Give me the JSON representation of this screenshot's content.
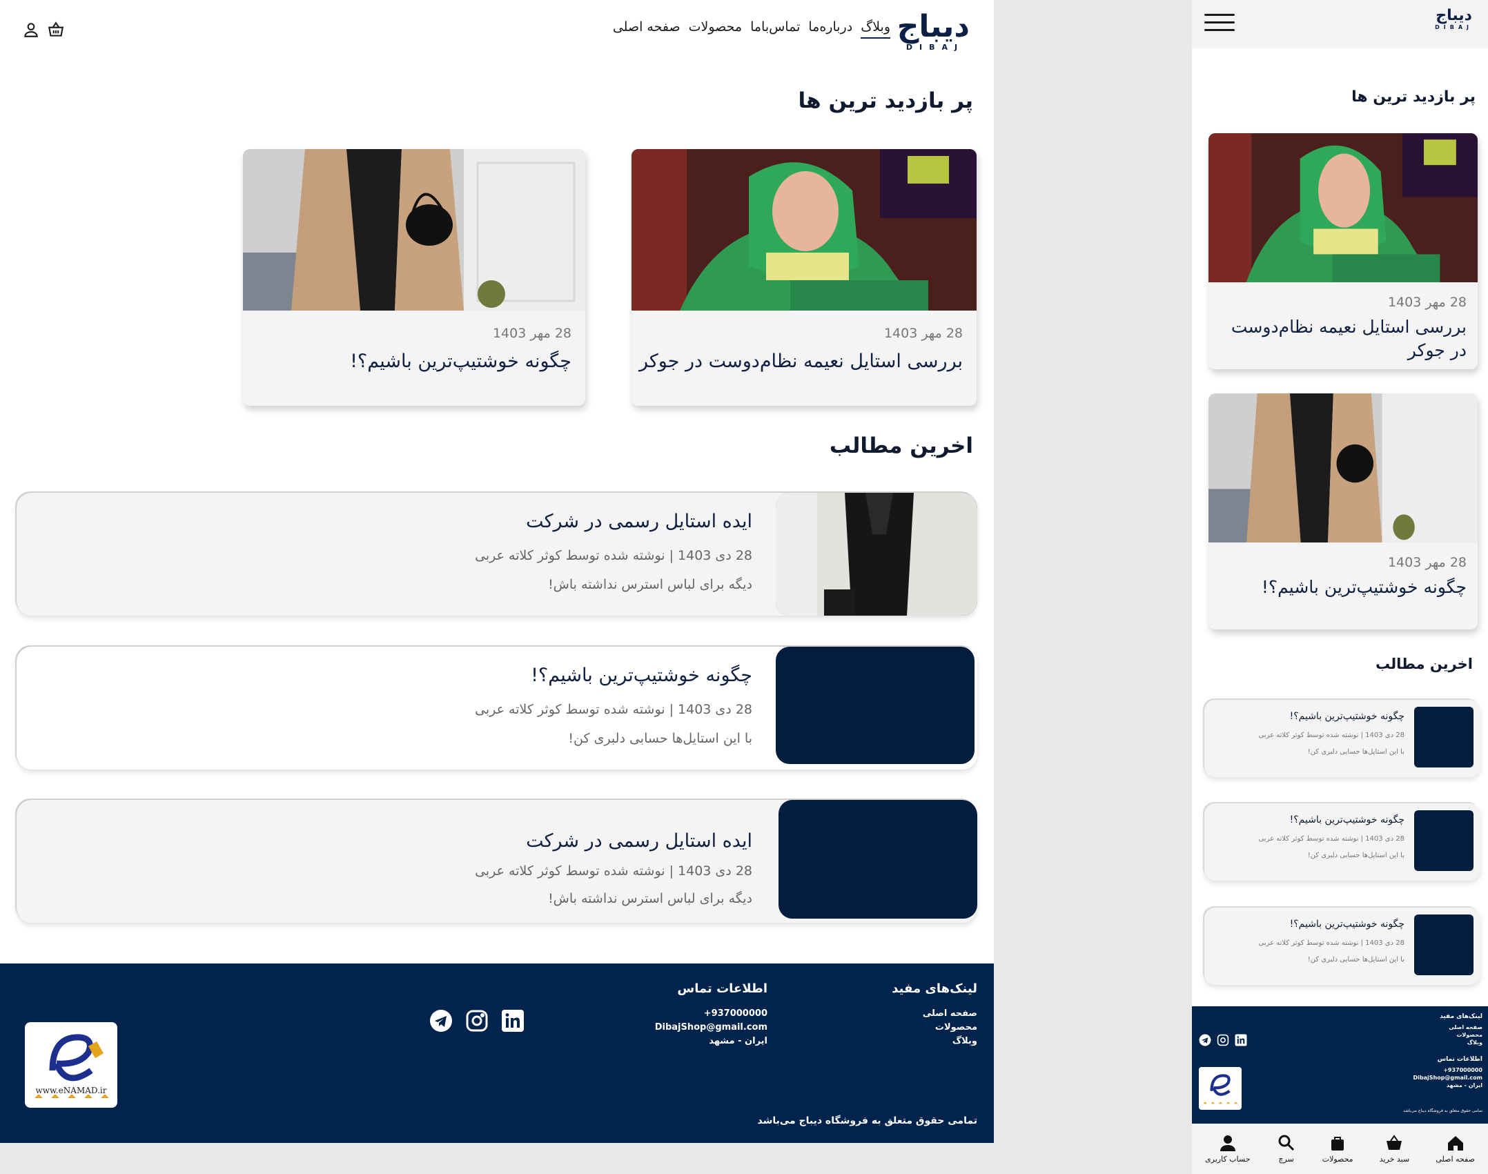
{
  "brand": {
    "name_fa": "دیباج",
    "name_en": "DIBAJ"
  },
  "nav": {
    "items": [
      "صفحه اصلی",
      "محصولات",
      "تماس‌باما",
      "درباره‌ما",
      "وبلاگ"
    ],
    "active": "وبلاگ"
  },
  "sections": {
    "popular_title": "پر بازدید ترین ها",
    "latest_title": "اخرین مطالب"
  },
  "popular": [
    {
      "date": "28 مهر 1403",
      "title": "بررسی استایل نعیمه نظام‌دوست در جوکر",
      "image": "woman-green-scarf"
    },
    {
      "date": "28 مهر 1403",
      "title": "چگونه خوشتیپ‌ترین باشیم؟!",
      "image": "coat-black-bag"
    }
  ],
  "latest": [
    {
      "title": "ایده استایل رسمی در شرکت",
      "meta": "28 دی 1403 | نوشته شده توسط کوثر کلاته عربی",
      "summary": "دیگه برای لباس استرس نداشته باش!"
    },
    {
      "title": "چگونه خوشتیپ‌ترین باشیم؟!",
      "meta": "28 دی 1403 | نوشته شده توسط کوثر کلاته عربی",
      "summary": "با این استایل‌ها حسابی دلبری کن!"
    },
    {
      "title": "ایده استایل رسمی در شرکت",
      "meta": "28 دی 1403 | نوشته شده توسط کوثر کلاته عربی",
      "summary": "دیگه برای لباس استرس نداشته باش!"
    }
  ],
  "mobile_latest": [
    {
      "title": "چگونه خوشتیپ‌ترین باشیم؟!",
      "meta": "28 دی 1403 | نوشته شده توسط کوثر کلاته عربی",
      "summary": "با این استایل‌ها حسابی دلبری کن!"
    },
    {
      "title": "چگونه خوشتیپ‌ترین باشیم؟!",
      "meta": "28 دی 1403 | نوشته شده توسط کوثر کلاته عربی",
      "summary": "با این استایل‌ها حسابی دلبری کن!"
    },
    {
      "title": "چگونه خوشتیپ‌ترین باشیم؟!",
      "meta": "28 دی 1403 | نوشته شده توسط کوثر کلاته عربی",
      "summary": "با این استایل‌ها حسابی دلبری کن!"
    }
  ],
  "footer": {
    "links_title": "لینک‌های مفید",
    "links": [
      "صفحه اصلی",
      "محصولات",
      "وبلاگ"
    ],
    "contact_title": "اطلاعات تماس",
    "phone": "+937000000",
    "email": "DibajShop@gmail.com",
    "address": "ایران - مشهد",
    "copyright": "تمامی حقوق متعلق به فروشگاه دیباج می‌باشد",
    "enamad_text": "www.eNAMAD.ir",
    "social": [
      "telegram-icon",
      "instagram-icon",
      "linkedin-icon"
    ]
  },
  "tabbar": [
    "صفحه اصلی",
    "سبد خرید",
    "محصولات",
    "سرچ",
    "حساب کاربری"
  ],
  "colors": {
    "primary": "#02234b",
    "card_bg": "#f4f4f4",
    "text": "#102040"
  }
}
